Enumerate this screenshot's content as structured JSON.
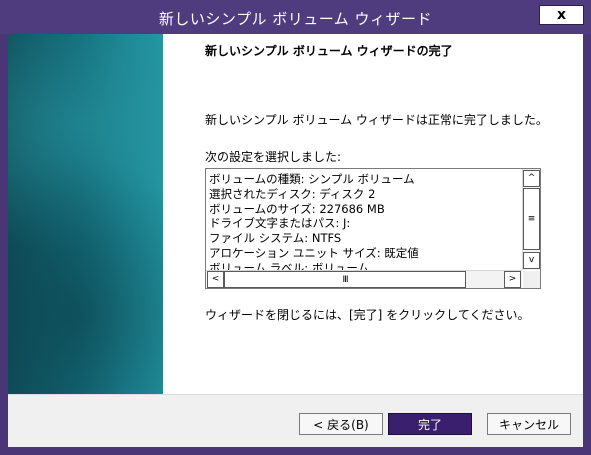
{
  "window": {
    "title": "新しいシンプル ボリューム ウィザード",
    "close_label": "x"
  },
  "main": {
    "heading": "新しいシンプル ボリューム ウィザードの完了",
    "success_text": "新しいシンプル ボリューム ウィザードは正常に完了しました。",
    "settings_label": "次の設定を選択しました:",
    "settings": [
      "ボリュームの種類: シンプル ボリューム",
      "選択されたディスク: ディスク 2",
      "ボリュームのサイズ: 227686 MB",
      "ドライブ文字またはパス: J:",
      "ファイル システム: NTFS",
      "アロケーション ユニット サイズ: 既定値",
      "ボリューム ラベル: ボリューム"
    ],
    "scroll_glyphs": {
      "up": "^",
      "down": "v",
      "left": "<",
      "right": ">",
      "vthumb": "≡",
      "hthumb": "III"
    },
    "close_note": "ウィザードを閉じるには、[完了] をクリックしてください。"
  },
  "footer": {
    "back_label": "< 戻る(B)",
    "finish_label": "完了",
    "cancel_label": "キャンセル"
  },
  "colors": {
    "title_bar": "#4f3c7e",
    "finish_button": "#3a1f6e",
    "side_panel": "#146a78"
  }
}
